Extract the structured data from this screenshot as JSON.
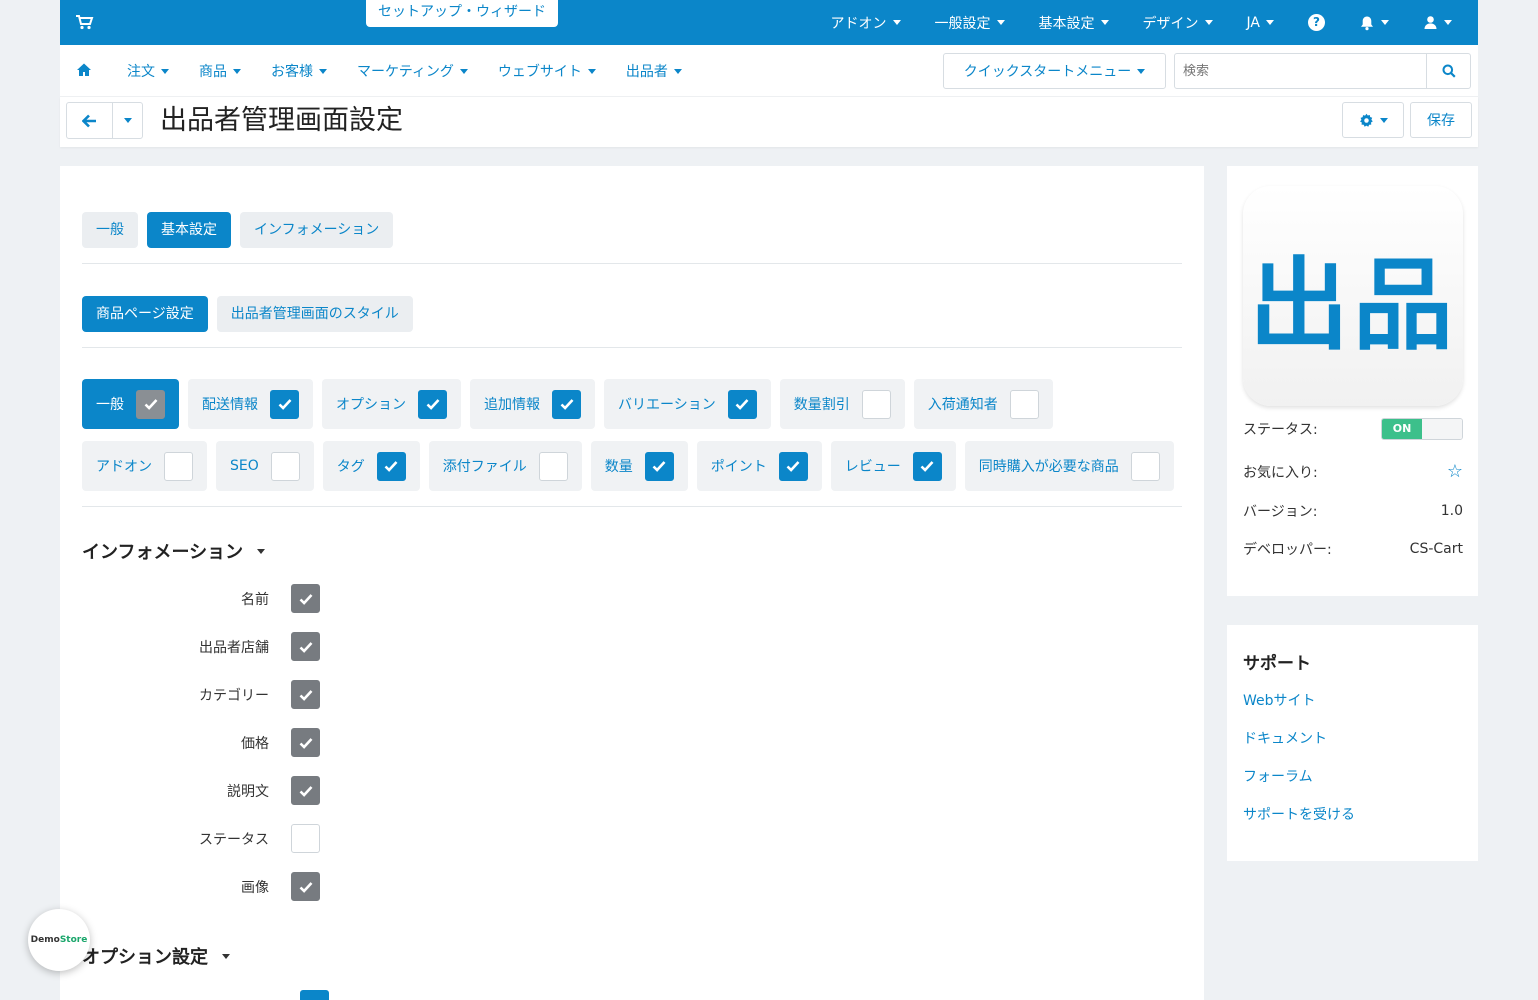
{
  "topbar": {
    "wizard": "セットアップ・ウィザード",
    "items": [
      "アドオン",
      "一般設定",
      "基本設定",
      "デザイン",
      "JA"
    ],
    "help": "?"
  },
  "subnav": {
    "items": [
      "注文",
      "商品",
      "お客様",
      "マーケティング",
      "ウェブサイト",
      "出品者"
    ],
    "quickstart": "クイックスタートメニュー",
    "search_placeholder": "検索"
  },
  "titlebar": {
    "title": "出品者管理画面設定",
    "save": "保存"
  },
  "tabs": [
    "一般",
    "基本設定",
    "インフォメーション"
  ],
  "subtabs": [
    "商品ページ設定",
    "出品者管理画面のスタイル"
  ],
  "tags": [
    {
      "label": "一般",
      "checked": true
    },
    {
      "label": "配送情報",
      "checked": true
    },
    {
      "label": "オプション",
      "checked": true
    },
    {
      "label": "追加情報",
      "checked": true
    },
    {
      "label": "バリエーション",
      "checked": true
    },
    {
      "label": "数量割引",
      "checked": false
    },
    {
      "label": "入荷通知者",
      "checked": false
    },
    {
      "label": "アドオン",
      "checked": false
    },
    {
      "label": "SEO",
      "checked": false
    },
    {
      "label": "タグ",
      "checked": true
    },
    {
      "label": "添付ファイル",
      "checked": false
    },
    {
      "label": "数量",
      "checked": true
    },
    {
      "label": "ポイント",
      "checked": true
    },
    {
      "label": "レビュー",
      "checked": true
    },
    {
      "label": "同時購入が必要な商品",
      "checked": false
    }
  ],
  "info_section": {
    "heading": "インフォメーション",
    "fields": [
      {
        "label": "名前",
        "checked": true
      },
      {
        "label": "出品者店舗",
        "checked": true
      },
      {
        "label": "カテゴリー",
        "checked": true
      },
      {
        "label": "価格",
        "checked": true
      },
      {
        "label": "説明文",
        "checked": true
      },
      {
        "label": "ステータス",
        "checked": false
      },
      {
        "label": "画像",
        "checked": true
      }
    ]
  },
  "options_section": {
    "heading": "オプション設定"
  },
  "sidebar": {
    "logo_text": "出品",
    "status_label": "ステータス:",
    "status_value": "ON",
    "favorite_label": "お気に入り:",
    "version_label": "バージョン:",
    "version_value": "1.0",
    "developer_label": "デベロッパー:",
    "developer_value": "CS-Cart"
  },
  "support": {
    "heading": "サポート",
    "links": [
      "Webサイト",
      "ドキュメント",
      "フォーラム",
      "サポートを受ける"
    ]
  },
  "demo_badge": {
    "part1": "Demo",
    "part2": "Store"
  }
}
